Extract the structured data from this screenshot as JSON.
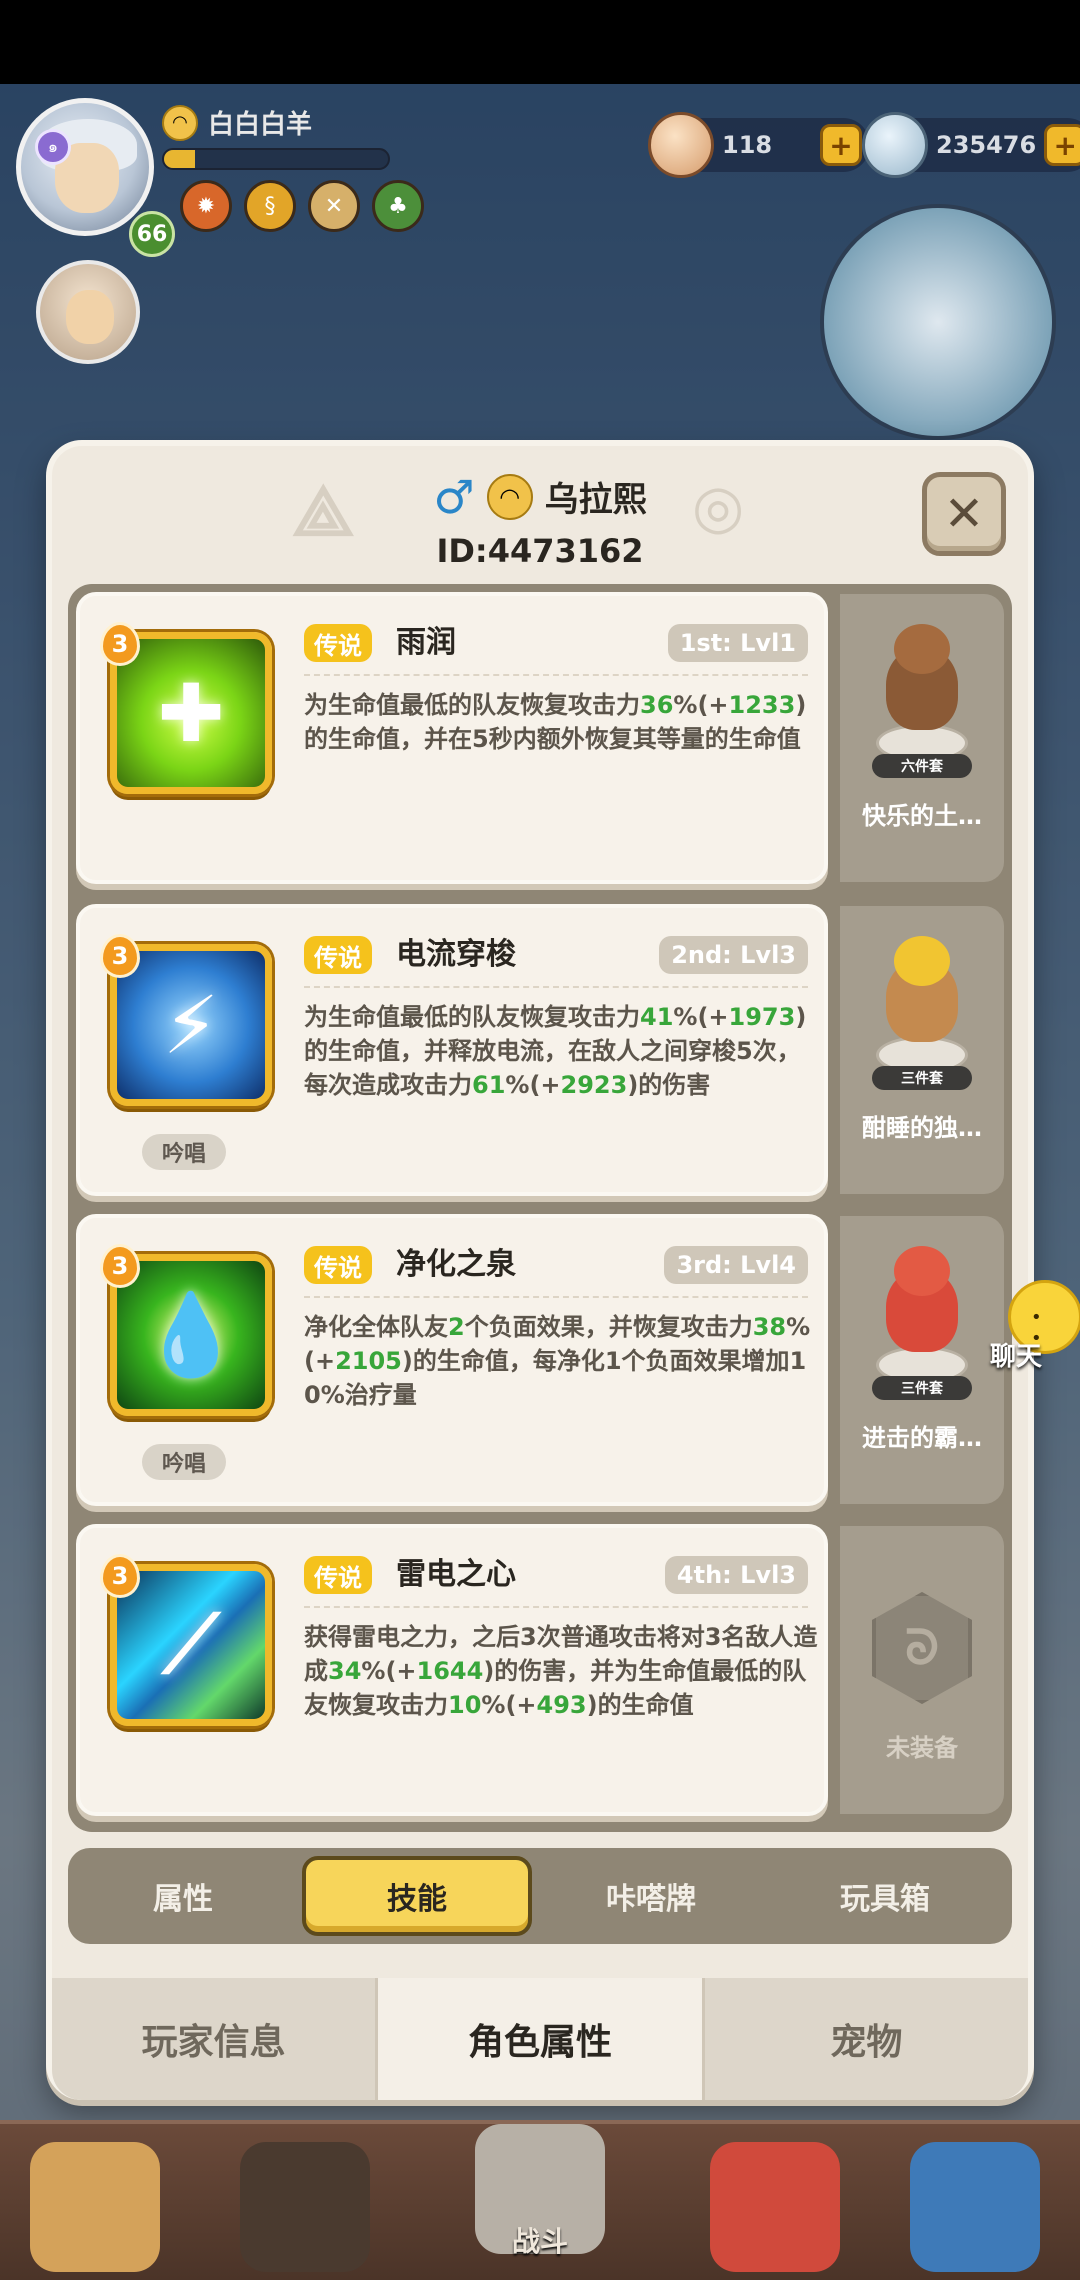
{
  "player": {
    "name": "白白白羊",
    "level": "66",
    "exp_fraction": 0.14,
    "buff_icons": [
      "fire-medal-icon",
      "flame-icon",
      "cross-icon",
      "cactus-icon"
    ]
  },
  "currency": [
    {
      "icon": "shell-star-icon",
      "amount": "118"
    },
    {
      "icon": "pearl-shell-icon",
      "amount": "235476"
    }
  ],
  "character": {
    "gender_symbol": "♂",
    "name": "乌拉熙",
    "id": "ID:4473162"
  },
  "skills": [
    {
      "count": "3",
      "rarity": "传说",
      "name": "雨润",
      "slot": "1st: Lvl1",
      "desc_parts": [
        "为生命值最低的队友恢复攻击力",
        "36",
        "%(+",
        "1233",
        ")的生命值，并在5秒内额外恢复其等量的生命值"
      ],
      "chant": "",
      "set": {
        "tag": "六件套",
        "name": "快乐的土…"
      }
    },
    {
      "count": "3",
      "rarity": "传说",
      "name": "电流穿梭",
      "slot": "2nd: Lvl3",
      "desc_parts": [
        "为生命值最低的队友恢复攻击力",
        "41",
        "%(+",
        "1973",
        ")的生命值，并释放电流，在敌人之间穿梭5次，每次造成攻击力",
        "61",
        "%(+",
        "2923",
        ")的伤害"
      ],
      "chant": "吟唱",
      "set": {
        "tag": "三件套",
        "name": "酣睡的独…"
      }
    },
    {
      "count": "3",
      "rarity": "传说",
      "name": "净化之泉",
      "slot": "3rd: Lvl4",
      "desc_parts": [
        "净化全体队友",
        "2",
        "个负面效果，并恢复攻击力",
        "38",
        "%(+",
        "2105",
        ")的生命值，每净化1个负面效果增加10%治疗量"
      ],
      "chant": "吟唱",
      "set": {
        "tag": "三件套",
        "name": "进击的霸…"
      }
    },
    {
      "count": "3",
      "rarity": "传说",
      "name": "雷电之心",
      "slot": "4th: Lvl3",
      "desc_parts": [
        "获得雷电之力，之后3次普通攻击将对3名敌人造成",
        "34",
        "%(+",
        "1644",
        ")的伤害，并为生命值最低的队友恢复攻击力",
        "10",
        "%(+",
        "493",
        ")的生命值"
      ],
      "chant": "",
      "set": {
        "tag": "",
        "name": "未装备"
      }
    }
  ],
  "tabs": [
    "属性",
    "技能",
    "咔嗒牌",
    "玩具箱"
  ],
  "bottom_tabs": [
    "玩家信息",
    "角色属性",
    "宠物"
  ],
  "chat_label": "聊天",
  "nav": {
    "battle_label": "战斗"
  },
  "colors": {
    "accent_yellow": "#f5c21c",
    "highlight_green": "#38a63a",
    "panel_bg": "#efe9df"
  }
}
